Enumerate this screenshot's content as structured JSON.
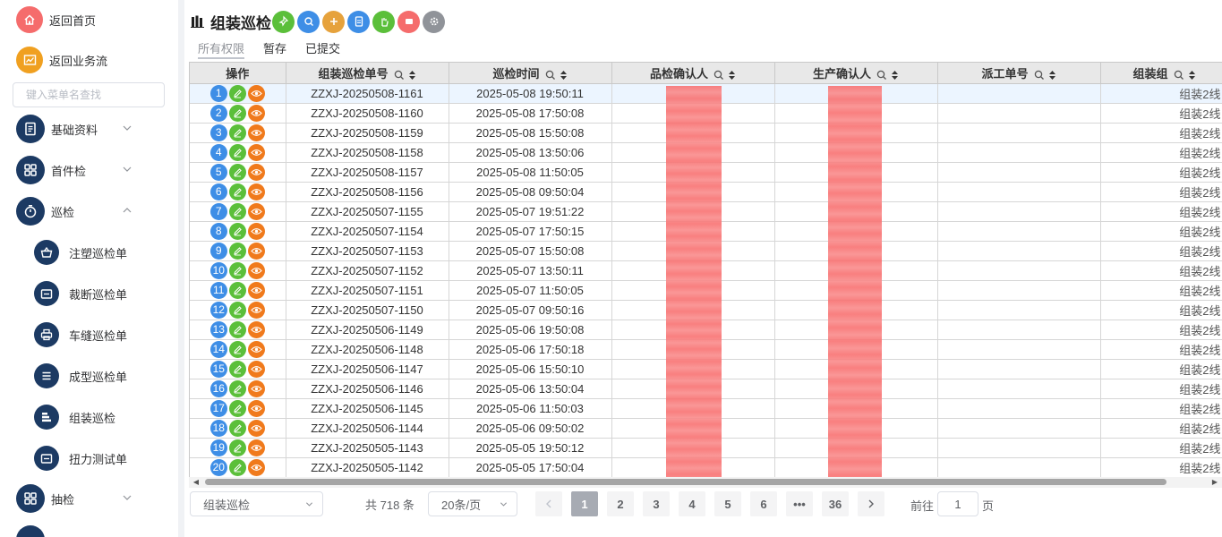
{
  "sidebar": {
    "quick_links": [
      {
        "label": "返回首页",
        "icon": "home-icon",
        "color": "#f56c6c"
      },
      {
        "label": "返回业务流",
        "icon": "workflow-icon",
        "color": "#f0a020"
      }
    ],
    "search_placeholder": "键入菜单名查找",
    "menus": [
      {
        "label": "基础资料",
        "icon": "document-icon",
        "expanded": false
      },
      {
        "label": "首件检",
        "icon": "grid-icon",
        "expanded": false
      },
      {
        "label": "巡检",
        "icon": "stopwatch-icon",
        "expanded": true
      },
      {
        "label": "抽检",
        "icon": "grid-icon",
        "expanded": false
      }
    ],
    "submenus": [
      {
        "label": "注塑巡检单",
        "icon": "basket-icon"
      },
      {
        "label": "裁断巡检单",
        "icon": "folder-icon"
      },
      {
        "label": "车缝巡检单",
        "icon": "printer-icon"
      },
      {
        "label": "成型巡检单",
        "icon": "list-icon"
      },
      {
        "label": "组装巡检",
        "icon": "stack-icon"
      },
      {
        "label": "扭力测试单",
        "icon": "folder-icon"
      }
    ]
  },
  "header": {
    "title": "组装巡检",
    "toolbar": [
      {
        "name": "pin-icon",
        "color": "#5bbf3a"
      },
      {
        "name": "search-icon",
        "color": "#3e8ee6"
      },
      {
        "name": "plus-icon",
        "color": "#e6a23c"
      },
      {
        "name": "document-icon",
        "color": "#3e8ee6"
      },
      {
        "name": "hand-icon",
        "color": "#5bbf3a"
      },
      {
        "name": "close-icon",
        "color": "#f56c6c"
      },
      {
        "name": "gear-icon",
        "color": "#909399"
      }
    ]
  },
  "tabs": [
    {
      "label": "所有权限",
      "active": true
    },
    {
      "label": "暂存",
      "active": false
    },
    {
      "label": "已提交",
      "active": false
    }
  ],
  "table": {
    "columns": [
      "操作",
      "组装巡检单号",
      "巡检时间",
      "品检确认人",
      "生产确认人",
      "派工单号",
      "组装组"
    ],
    "rows": [
      {
        "n": "1",
        "id": "ZZXJ-20250508-1161",
        "time": "2025-05-08 19:50:11",
        "dispatch": "",
        "group": "组装2线"
      },
      {
        "n": "2",
        "id": "ZZXJ-20250508-1160",
        "time": "2025-05-08 17:50:08",
        "dispatch": "",
        "group": "组装2线"
      },
      {
        "n": "3",
        "id": "ZZXJ-20250508-1159",
        "time": "2025-05-08 15:50:08",
        "dispatch": "",
        "group": "组装2线"
      },
      {
        "n": "4",
        "id": "ZZXJ-20250508-1158",
        "time": "2025-05-08 13:50:06",
        "dispatch": "",
        "group": "组装2线"
      },
      {
        "n": "5",
        "id": "ZZXJ-20250508-1157",
        "time": "2025-05-08 11:50:05",
        "dispatch": "",
        "group": "组装2线"
      },
      {
        "n": "6",
        "id": "ZZXJ-20250508-1156",
        "time": "2025-05-08 09:50:04",
        "dispatch": "",
        "group": "组装2线"
      },
      {
        "n": "7",
        "id": "ZZXJ-20250507-1155",
        "time": "2025-05-07 19:51:22",
        "dispatch": "",
        "group": "组装2线"
      },
      {
        "n": "8",
        "id": "ZZXJ-20250507-1154",
        "time": "2025-05-07 17:50:15",
        "dispatch": "",
        "group": "组装2线"
      },
      {
        "n": "9",
        "id": "ZZXJ-20250507-1153",
        "time": "2025-05-07 15:50:08",
        "dispatch": "",
        "group": "组装2线"
      },
      {
        "n": "10",
        "id": "ZZXJ-20250507-1152",
        "time": "2025-05-07 13:50:11",
        "dispatch": "",
        "group": "组装2线"
      },
      {
        "n": "11",
        "id": "ZZXJ-20250507-1151",
        "time": "2025-05-07 11:50:05",
        "dispatch": "",
        "group": "组装2线"
      },
      {
        "n": "12",
        "id": "ZZXJ-20250507-1150",
        "time": "2025-05-07 09:50:16",
        "dispatch": "",
        "group": "组装2线"
      },
      {
        "n": "13",
        "id": "ZZXJ-20250506-1149",
        "time": "2025-05-06 19:50:08",
        "dispatch": "",
        "group": "组装2线"
      },
      {
        "n": "14",
        "id": "ZZXJ-20250506-1148",
        "time": "2025-05-06 17:50:18",
        "dispatch": "",
        "group": "组装2线"
      },
      {
        "n": "15",
        "id": "ZZXJ-20250506-1147",
        "time": "2025-05-06 15:50:10",
        "dispatch": "",
        "group": "组装2线"
      },
      {
        "n": "16",
        "id": "ZZXJ-20250506-1146",
        "time": "2025-05-06 13:50:04",
        "dispatch": "",
        "group": "组装2线"
      },
      {
        "n": "17",
        "id": "ZZXJ-20250506-1145",
        "time": "2025-05-06 11:50:03",
        "dispatch": "",
        "group": "组装2线"
      },
      {
        "n": "18",
        "id": "ZZXJ-20250506-1144",
        "time": "2025-05-06 09:50:02",
        "dispatch": "",
        "group": "组装2线"
      },
      {
        "n": "19",
        "id": "ZZXJ-20250505-1143",
        "time": "2025-05-05 19:50:12",
        "dispatch": "",
        "group": "组装2线"
      },
      {
        "n": "20",
        "id": "ZZXJ-20250505-1142",
        "time": "2025-05-05 17:50:04",
        "dispatch": "",
        "group": "组装2线"
      }
    ]
  },
  "pager": {
    "form_select": "组装巡检",
    "total": "共 718 条",
    "page_size": "20条/页",
    "pages": [
      "1",
      "2",
      "3",
      "4",
      "5",
      "6",
      "•••",
      "36"
    ],
    "current": "1",
    "goto_prefix": "前往",
    "goto_value": "1",
    "goto_suffix": "页"
  },
  "colors": {
    "accent": "#1c3a63",
    "redaction": "#f87171"
  }
}
